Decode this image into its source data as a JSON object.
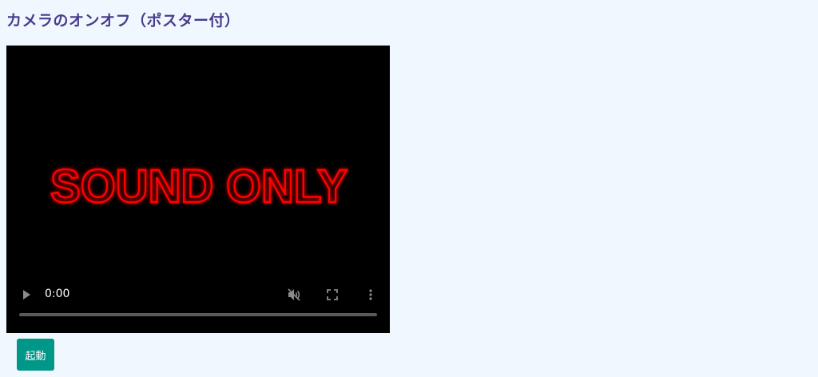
{
  "page": {
    "title": "カメラのオンオフ（ポスター付）"
  },
  "video": {
    "poster_text": "SOUND ONLY",
    "poster_color": "#ff0000",
    "current_time": "0:00",
    "muted": true,
    "progress": 0,
    "controls": {
      "play_icon": "play-icon",
      "mute_icon": "volume-muted-icon",
      "fullscreen_icon": "fullscreen-icon",
      "more_icon": "more-vertical-icon"
    }
  },
  "actions": {
    "start_label": "起動",
    "start_color": "#009688"
  },
  "colors": {
    "background": "#f0f7ff",
    "title": "#483d8b"
  }
}
